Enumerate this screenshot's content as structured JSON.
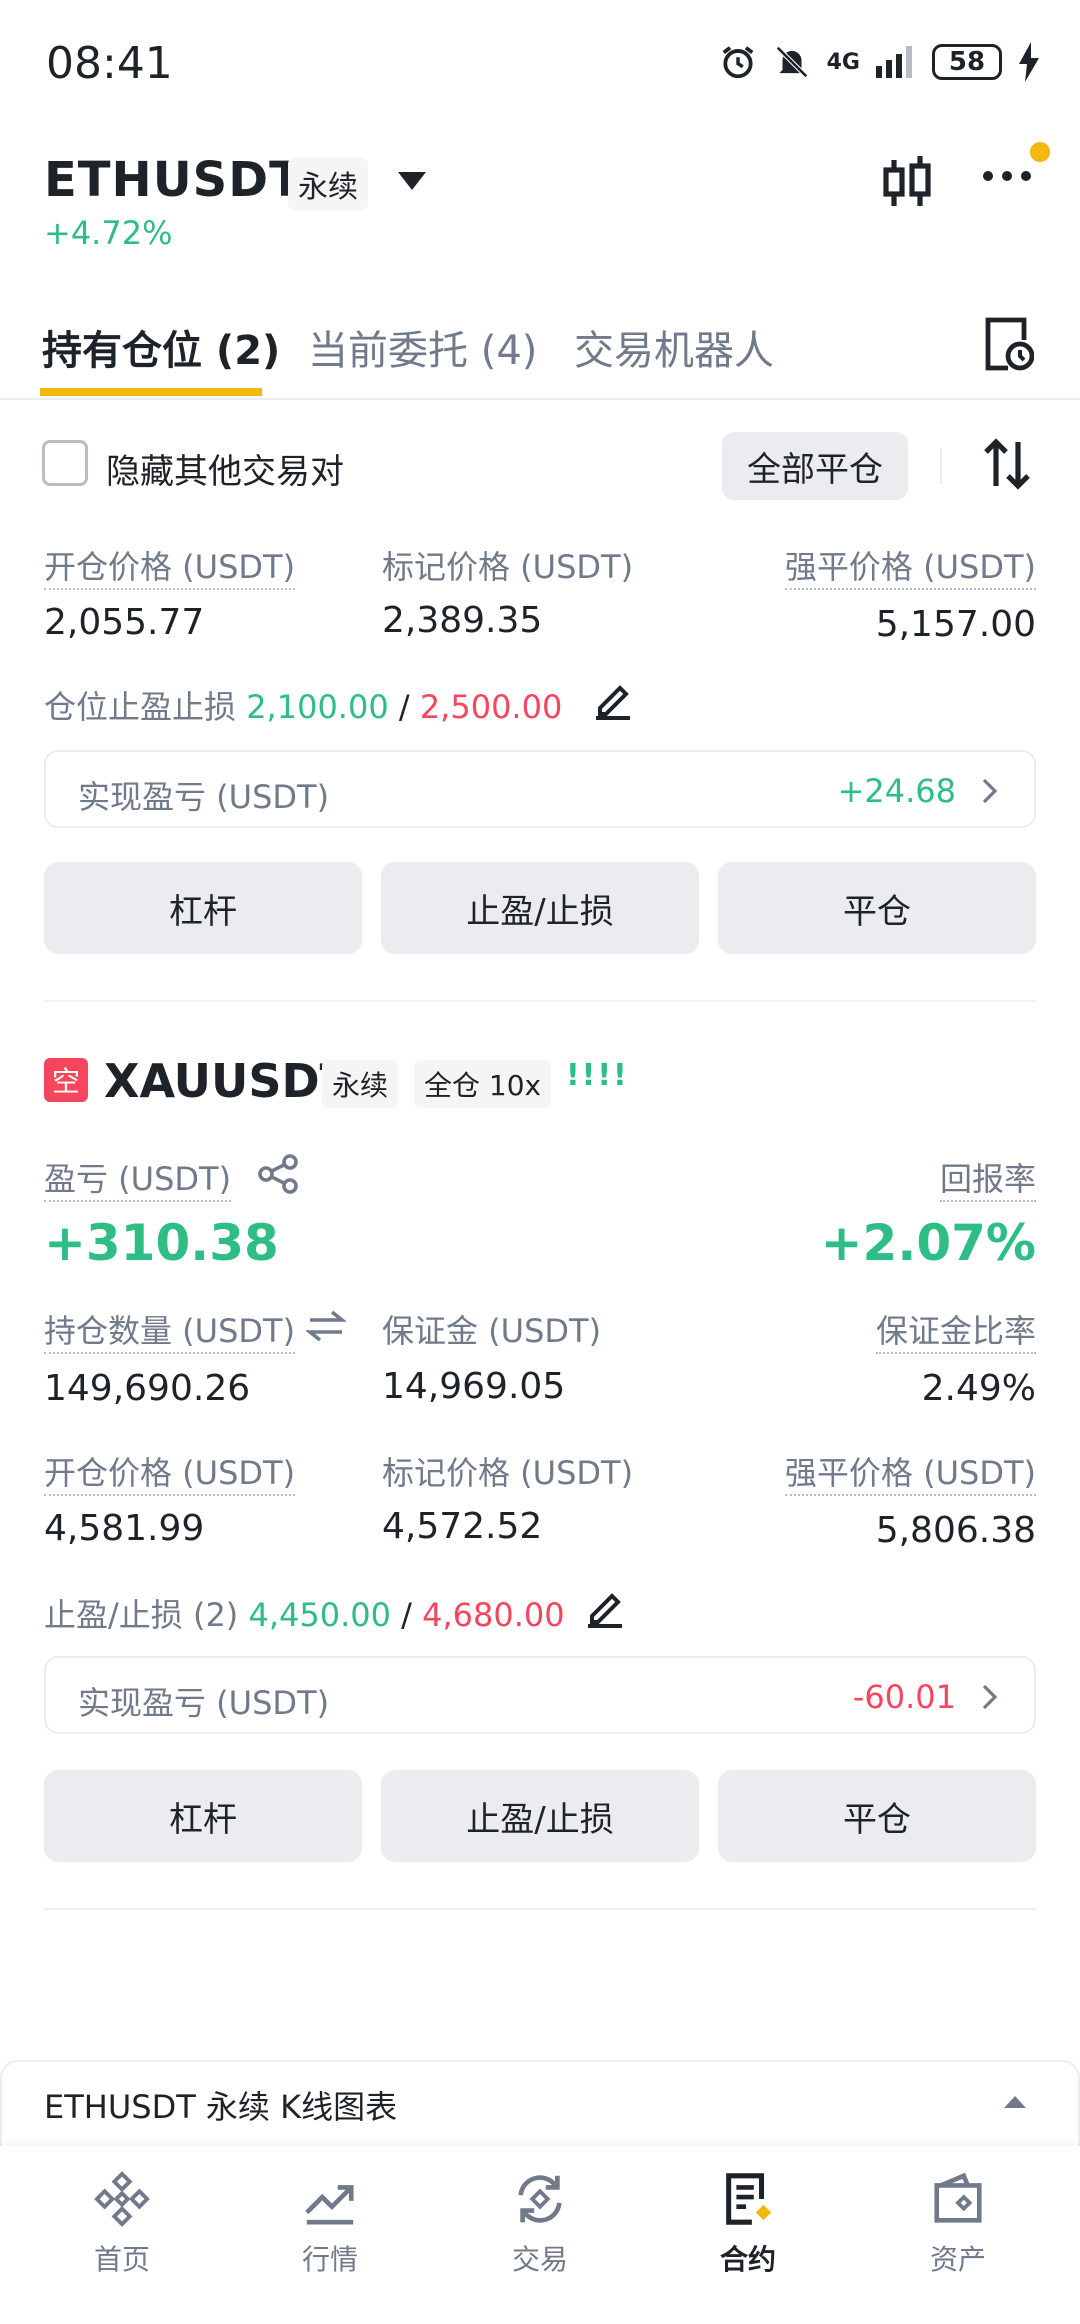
{
  "status_bar": {
    "time": "08:41",
    "network": "4G",
    "battery": "58"
  },
  "header": {
    "symbol": "ETHUSDT",
    "contract_type": "永续",
    "change": "+4.72%"
  },
  "tabs": [
    {
      "label": "持有仓位 (2)",
      "active": true
    },
    {
      "label": "当前委托 (4)",
      "active": false
    },
    {
      "label": "交易机器人",
      "active": false
    }
  ],
  "filter": {
    "hide_others_label": "隐藏其他交易对",
    "close_all_label": "全部平仓"
  },
  "position1": {
    "entry_label": "开仓价格 (USDT)",
    "entry_value": "2,055.77",
    "mark_label": "标记价格 (USDT)",
    "mark_value": "2,389.35",
    "liq_label": "强平价格 (USDT)",
    "liq_value": "5,157.00",
    "tpsl_label": "仓位止盈止损",
    "tp": "2,100.00",
    "slash": "/",
    "sl": "2,500.00",
    "realized_label": "实现盈亏 (USDT)",
    "realized_value": "+24.68",
    "btn_leverage": "杠杆",
    "btn_tpsl": "止盈/止损",
    "btn_close": "平仓"
  },
  "position2": {
    "side_badge": "空",
    "symbol": "XAUUSDT",
    "contract_type": "永续",
    "margin_mode": "全仓 10x",
    "adl": "!!!!",
    "pnl_label": "盈亏 (USDT)",
    "pnl_value": "+310.38",
    "roe_label": "回报率",
    "roe_value": "+2.07%",
    "size_label": "持仓数量 (USDT)",
    "size_value": "149,690.26",
    "margin_label": "保证金 (USDT)",
    "margin_value": "14,969.05",
    "margin_ratio_label": "保证金比率",
    "margin_ratio_value": "2.49%",
    "entry_label": "开仓价格 (USDT)",
    "entry_value": "4,581.99",
    "mark_label": "标记价格 (USDT)",
    "mark_value": "4,572.52",
    "liq_label": "强平价格 (USDT)",
    "liq_value": "5,806.38",
    "tpsl_label": "止盈/止损 (2)",
    "tp": "4,450.00",
    "slash": "/",
    "sl": "4,680.00",
    "realized_label": "实现盈亏 (USDT)",
    "realized_value": "-60.01",
    "btn_leverage": "杠杆",
    "btn_tpsl": "止盈/止损",
    "btn_close": "平仓"
  },
  "kline_sheet": {
    "title": "ETHUSDT 永续 K线图表"
  },
  "bottom_nav": [
    {
      "label": "首页",
      "icon": "home-icon"
    },
    {
      "label": "行情",
      "icon": "markets-icon"
    },
    {
      "label": "交易",
      "icon": "trade-icon"
    },
    {
      "label": "合约",
      "icon": "futures-icon",
      "active": true
    },
    {
      "label": "资产",
      "icon": "wallet-icon"
    }
  ],
  "colors": {
    "accent": "#f0b90b",
    "up": "#2ebd85",
    "down": "#f6465d",
    "text": "#1e2329",
    "muted": "#707a8a"
  }
}
